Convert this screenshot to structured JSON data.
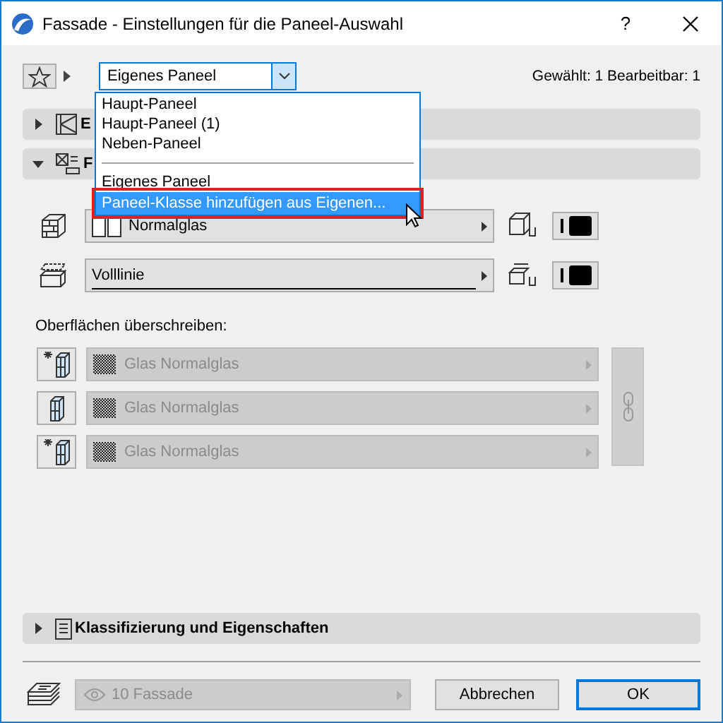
{
  "window": {
    "title": "Fassade - Einstellungen für die Paneel-Auswahl",
    "help": "?"
  },
  "toolbar": {
    "preset_combo": "Eigenes Paneel",
    "status": "Gewählt: 1 Bearbeitbar: 1"
  },
  "dropdown": {
    "groups": [
      [
        {
          "label": "Haupt-Paneel",
          "selected": false
        },
        {
          "label": "Haupt-Paneel (1)",
          "selected": false
        },
        {
          "label": "Neben-Paneel",
          "selected": false
        }
      ],
      [
        {
          "label": "Eigenes Paneel",
          "selected": false
        },
        {
          "label": "Paneel-Klasse hinzufügen aus Eigenen...",
          "selected": true
        }
      ]
    ]
  },
  "top_sections": [
    {
      "title": "E",
      "expanded": false
    },
    {
      "title": "F",
      "expanded": true
    }
  ],
  "panel": {
    "material_field": "Normalglas",
    "line_field": "Volllinie"
  },
  "surfaces": {
    "label": "Oberflächen überschreiben:",
    "rows": [
      {
        "value": "Glas Normalglas",
        "disabled": true
      },
      {
        "value": "Glas Normalglas",
        "disabled": true
      },
      {
        "value": "Glas Normalglas",
        "disabled": true
      }
    ]
  },
  "bottom_section": {
    "title": "Klassifizierung und Eigenschaften",
    "expanded": false
  },
  "footer": {
    "layer": "10 Fassade",
    "layer_disabled": true,
    "buttons": [
      {
        "label": "Abbrechen",
        "default": false
      },
      {
        "label": "OK",
        "default": true
      }
    ]
  }
}
